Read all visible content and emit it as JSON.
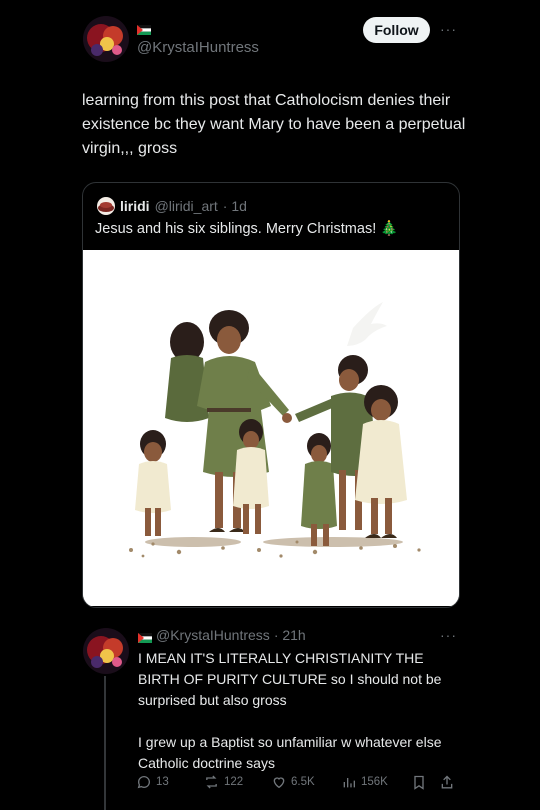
{
  "main_tweet": {
    "handle": "@KrystaIHuntress",
    "follow_label": "Follow",
    "more_label": "···",
    "text": "learning from this post that Catholocism denies their existence bc they want Mary to have been a perpetual virgin,,, gross"
  },
  "quoted_tweet": {
    "display_name": "liridi",
    "handle": "@liridi_art",
    "time": "· 1d",
    "text": "Jesus and his six siblings. Merry Christmas! 🎄"
  },
  "reply": {
    "handle": "@KrystaIHuntress",
    "time": "· 21h",
    "more_label": "···",
    "paragraph1": "I MEAN IT'S LITERALLY CHRISTIANITY THE BIRTH OF PURITY CULTURE so I should not be surprised but also gross",
    "paragraph2": "I grew up a Baptist so unfamiliar w whatever else Catholic doctrine says",
    "actions": {
      "replies": "13",
      "reposts": "122",
      "likes": "6.5K",
      "views": "156K"
    }
  },
  "colors": {
    "background": "#000000",
    "text": "#e7e9ea",
    "muted": "#71767b",
    "border": "#2f3336",
    "robe_green": "#6f7f4a",
    "robe_cream": "#f1ead0"
  }
}
